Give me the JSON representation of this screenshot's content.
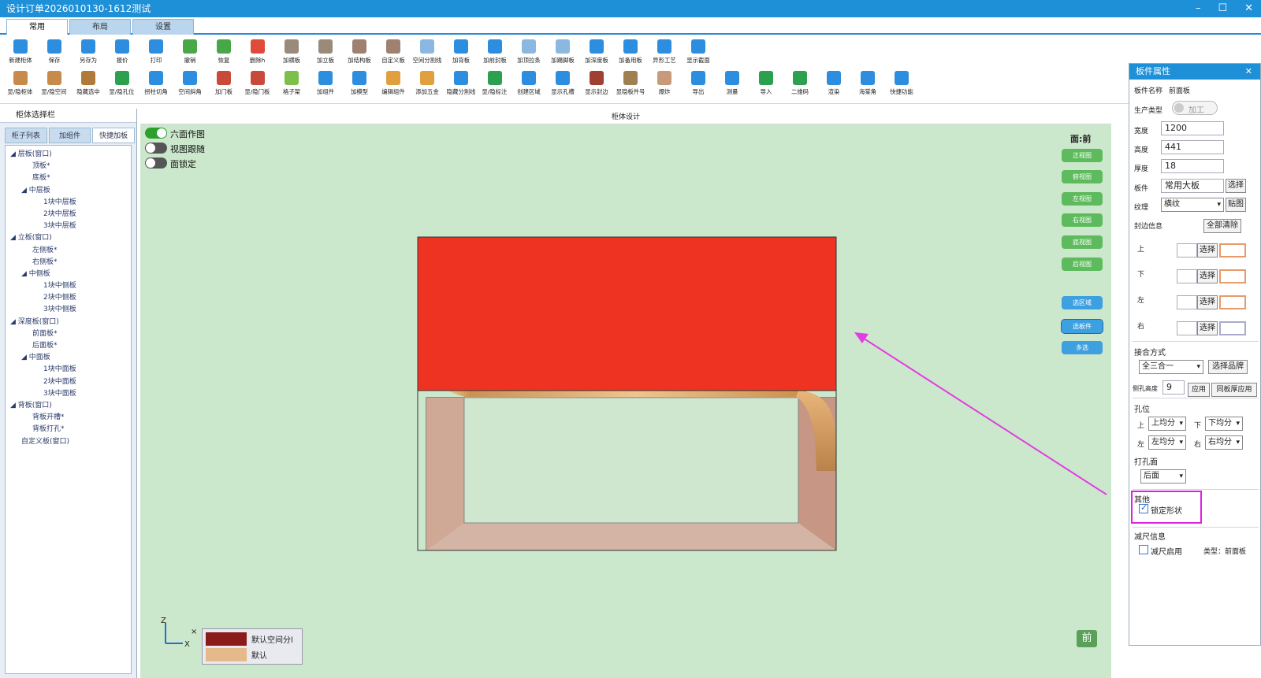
{
  "window": {
    "title": "设计订单2026010130-1612测试",
    "minimize": "–",
    "restore": "☐",
    "close": "✕"
  },
  "main_tabs": [
    {
      "label": "常用",
      "active": true
    },
    {
      "label": "布局",
      "active": false
    },
    {
      "label": "设置",
      "active": false
    }
  ],
  "toolbar_row1": [
    {
      "label": "新建柜体",
      "color": "#2d8ee0"
    },
    {
      "label": "保存",
      "color": "#2d8ee0"
    },
    {
      "label": "另存为",
      "color": "#2d8ee0"
    },
    {
      "label": "报价",
      "color": "#2d8ee0"
    },
    {
      "label": "打印",
      "color": "#2d8ee0"
    },
    {
      "label": "撤销",
      "color": "#48a848"
    },
    {
      "label": "恢复",
      "color": "#48a848"
    },
    {
      "label": "删除h",
      "color": "#e04a3a"
    },
    {
      "label": "加横板",
      "color": "#9a8a7a"
    },
    {
      "label": "加立板",
      "color": "#9a8a7a"
    },
    {
      "label": "加结构板",
      "color": "#a08070"
    },
    {
      "label": "自定义板",
      "color": "#a08070"
    },
    {
      "label": "空间分割线",
      "color": "#8ab8e0"
    },
    {
      "label": "加背板",
      "color": "#2d8ee0"
    },
    {
      "label": "加前封板",
      "color": "#2d8ee0"
    },
    {
      "label": "加顶拉条",
      "color": "#8ab8e0"
    },
    {
      "label": "加踢脚板",
      "color": "#8ab8e0"
    },
    {
      "label": "加深度板",
      "color": "#2d8ee0"
    },
    {
      "label": "加备用板",
      "color": "#2d8ee0"
    },
    {
      "label": "异形工艺",
      "color": "#2d8ee0"
    },
    {
      "label": "显示截面",
      "color": "#2d8ee0"
    }
  ],
  "toolbar_row2": [
    {
      "label": "显/隐柜体",
      "color": "#c88a4a"
    },
    {
      "label": "显/隐空间",
      "color": "#c88a4a"
    },
    {
      "label": "隐藏选中",
      "color": "#b07a3a"
    },
    {
      "label": "显/隐孔位",
      "color": "#2da050"
    },
    {
      "label": "拐柱切角",
      "color": "#2d8ee0"
    },
    {
      "label": "空间斜角",
      "color": "#2d8ee0"
    },
    {
      "label": "加门板",
      "color": "#c84a3a"
    },
    {
      "label": "显/隐门板",
      "color": "#c84a3a"
    },
    {
      "label": "格子架",
      "color": "#7ac04a"
    },
    {
      "label": "加组件",
      "color": "#2d8ee0"
    },
    {
      "label": "加模型",
      "color": "#2d8ee0"
    },
    {
      "label": "编辑组件",
      "color": "#e0a040"
    },
    {
      "label": "添加五金",
      "color": "#e0a040"
    },
    {
      "label": "隐藏分割线",
      "color": "#2d8ee0"
    },
    {
      "label": "显/隐标注",
      "color": "#2da050"
    },
    {
      "label": "创建区域",
      "color": "#2d8ee0"
    },
    {
      "label": "显示孔槽",
      "color": "#2d8ee0"
    },
    {
      "label": "显示封边",
      "color": "#a04030"
    },
    {
      "label": "显隐板件号",
      "color": "#a08050"
    },
    {
      "label": "爆炸",
      "color": "#c89a7a"
    },
    {
      "label": "导出",
      "color": "#2d8ee0"
    },
    {
      "label": "测量",
      "color": "#2d8ee0"
    },
    {
      "label": "导入",
      "color": "#2da050"
    },
    {
      "label": "二维码",
      "color": "#2da050"
    },
    {
      "label": "渲染",
      "color": "#2d8ee0"
    },
    {
      "label": "海棠角",
      "color": "#2d8ee0"
    },
    {
      "label": "快捷功能",
      "color": "#2d8ee0"
    }
  ],
  "left_panel": {
    "header": "柜体选择栏",
    "tabs": [
      {
        "label": "柜子列表",
        "active": false
      },
      {
        "label": "加组件",
        "active": false
      },
      {
        "label": "快捷加板",
        "active": true
      }
    ],
    "tree": [
      {
        "label": "◢ 层板(窗口)",
        "level": 0
      },
      {
        "label": "顶板*",
        "level": 2
      },
      {
        "label": "底板*",
        "level": 2
      },
      {
        "label": "◢ 中层板",
        "level": 1
      },
      {
        "label": "1块中层板",
        "level": 3
      },
      {
        "label": "2块中层板",
        "level": 3
      },
      {
        "label": "3块中层板",
        "level": 3
      },
      {
        "label": "◢ 立板(窗口)",
        "level": 0
      },
      {
        "label": "左侧板*",
        "level": 2
      },
      {
        "label": "右侧板*",
        "level": 2
      },
      {
        "label": "◢ 中侧板",
        "level": 1
      },
      {
        "label": "1块中侧板",
        "level": 3
      },
      {
        "label": "2块中侧板",
        "level": 3
      },
      {
        "label": "3块中侧板",
        "level": 3
      },
      {
        "label": "◢ 深度板(窗口)",
        "level": 0
      },
      {
        "label": "前面板*",
        "level": 2
      },
      {
        "label": "后面板*",
        "level": 2
      },
      {
        "label": "◢ 中面板",
        "level": 1
      },
      {
        "label": "1块中面板",
        "level": 3
      },
      {
        "label": "2块中面板",
        "level": 3
      },
      {
        "label": "3块中面板",
        "level": 3
      },
      {
        "label": "◢ 背板(窗口)",
        "level": 0
      },
      {
        "label": "背板开槽*",
        "level": 2
      },
      {
        "label": "背板打孔*",
        "level": 2
      },
      {
        "label": "自定义板(窗口)",
        "level": 1
      }
    ]
  },
  "canvas": {
    "header": "柜体设计",
    "toggles": [
      {
        "label": "六面作图",
        "on": true
      },
      {
        "label": "视图跟随",
        "on": false
      },
      {
        "label": "面锁定",
        "on": false
      }
    ],
    "face_label": "面:前",
    "view_buttons": [
      "正视图",
      "俯视图",
      "左视图",
      "右视图",
      "底视图",
      "后视图"
    ],
    "select_buttons": [
      "选区域",
      "选板件",
      "多选"
    ],
    "legend": [
      {
        "label": "默认空间分l",
        "color": "#8b1a1a"
      },
      {
        "label": "默认",
        "color": "#e6b98a"
      }
    ],
    "axis": {
      "z": "Z",
      "x": "X",
      "y": "×"
    },
    "front_badge": "前"
  },
  "properties": {
    "title": "板件属性",
    "close": "✕",
    "name_label": "板件名称",
    "name_value": "前面板",
    "production_label": "生产类型",
    "production_value": "加工",
    "width_label": "宽度",
    "width_value": "1200",
    "height_label": "高度",
    "height_value": "441",
    "thickness_label": "厚度",
    "thickness_value": "18",
    "material_label": "板件",
    "material_value": "常用大板",
    "select_btn": "选择",
    "grain_label": "纹理",
    "grain_value": "横纹",
    "texture_btn": "贴图",
    "edge_label": "封边信息",
    "clear_all_btn": "全部清除",
    "edge_top": "上",
    "edge_bottom": "下",
    "edge_left": "左",
    "edge_right": "右",
    "join_label": "接合方式",
    "join_value": "全三合一",
    "select_brand_btn": "选择品牌",
    "hole_depth_label": "侧孔高度",
    "hole_depth_value": "9",
    "apply_btn": "应用",
    "same_thickness_btn": "同板厚应用",
    "hole_section": "孔位",
    "hole_top_label": "上",
    "hole_top_value": "上均分",
    "hole_bottom_label": "下",
    "hole_bottom_value": "下均分",
    "hole_left_label": "左",
    "hole_left_value": "左均分",
    "hole_right_label": "右",
    "hole_right_value": "右均分",
    "drill_face_label": "打孔面",
    "drill_face_value": "后面",
    "other_label": "其他",
    "lock_shape_label": "锁定形状",
    "lock_shape_checked": true,
    "reduce_label": "减尺信息",
    "reduce_enable_label": "减尺启用",
    "reduce_enable_checked": false,
    "reduce_type": "类型：前面板"
  }
}
